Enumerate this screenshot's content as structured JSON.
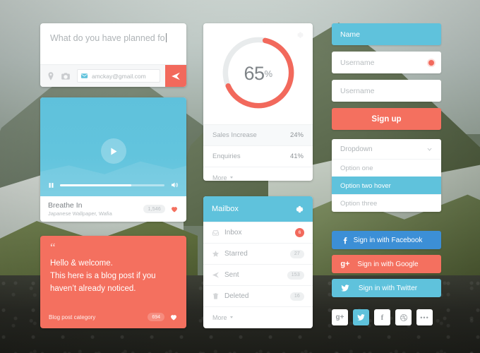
{
  "theme": {
    "coral": "#F4705F",
    "coral_dark": "#F2695C",
    "blue": "#5FC2DC",
    "facebook_blue": "#3C8FD6",
    "google_coral": "#F4705F",
    "twitter_blue": "#5FC2DC",
    "text_grey": "#A7ACB0"
  },
  "compose": {
    "message": "What do you have planned fo",
    "location_icon": "location-pin-icon",
    "camera_icon": "camera-icon",
    "email_icon": "envelope-icon",
    "email_value": "amckay@gmail.com",
    "send_icon": "send-paper-plane-icon"
  },
  "video": {
    "play_icon": "play-icon",
    "pause_icon": "pause-icon",
    "volume_icon": "volume-icon",
    "progress_percent": 68,
    "title": "Breathe In",
    "subtitle": "Japanese Wallpaper, Wafia",
    "count": "1,546",
    "like_icon": "heart-icon"
  },
  "blog": {
    "quote_mark": "“",
    "line1": "Hello & welcome.",
    "line2": "This here is a blog post if you",
    "line3": "haven’t already noticed.",
    "category": "Blog post category",
    "count": "694",
    "like_icon": "heart-icon"
  },
  "gauge": {
    "gear_icon": "gear-icon",
    "value": "65",
    "unit": "%",
    "percent": 65,
    "arc_color": "#F2695C",
    "track_color": "#E8EBEC",
    "stats": [
      {
        "name": "Sales Increase",
        "value": "24%",
        "highlighted": true
      },
      {
        "name": "Enquiries",
        "value": "41%",
        "highlighted": false
      }
    ],
    "more_label": "More"
  },
  "mailbox": {
    "title": "Mailbox",
    "gear_icon": "gear-icon",
    "rows": [
      {
        "label": "Inbox",
        "icon": "inbox-icon",
        "badge": "6",
        "badge_style": "red"
      },
      {
        "label": "Starred",
        "icon": "star-icon",
        "badge": "27",
        "badge_style": "grey"
      },
      {
        "label": "Sent",
        "icon": "send-icon",
        "badge": "153",
        "badge_style": "grey"
      },
      {
        "label": "Deleted",
        "icon": "trash-icon",
        "badge": "16",
        "badge_style": "grey"
      }
    ],
    "more_label": "More"
  },
  "signup": {
    "fields": [
      {
        "value": "Name",
        "state": "active",
        "has_dot": false
      },
      {
        "value": "Username",
        "state": "inactive",
        "has_dot": true
      },
      {
        "value": "Username",
        "state": "inactive",
        "has_dot": false
      }
    ],
    "submit_label": "Sign up"
  },
  "dropdown": {
    "selected": "Dropdown",
    "chevron_icon": "chevron-down-icon",
    "options": [
      {
        "label": "Option one",
        "hover": false
      },
      {
        "label": "Option two hover",
        "hover": true
      },
      {
        "label": "Option three",
        "hover": false
      }
    ]
  },
  "socials": [
    {
      "label": "Sign in with Facebook",
      "icon": "facebook-icon",
      "color": "#3C8FD6"
    },
    {
      "label": "Sign in with Google",
      "icon": "google-plus-icon",
      "color": "#F4705F"
    },
    {
      "label": "Sign in with Twitter",
      "icon": "twitter-icon",
      "color": "#5FC2DC"
    }
  ],
  "tiles": [
    {
      "icon": "google-plus-icon",
      "glyph": "g+",
      "active": false
    },
    {
      "icon": "twitter-icon",
      "glyph": "",
      "active": true
    },
    {
      "icon": "facebook-icon",
      "glyph": "f",
      "active": false
    },
    {
      "icon": "dribbble-icon",
      "glyph": "",
      "active": false
    },
    {
      "icon": "more-ellipsis-icon",
      "glyph": "•••",
      "active": false
    }
  ]
}
